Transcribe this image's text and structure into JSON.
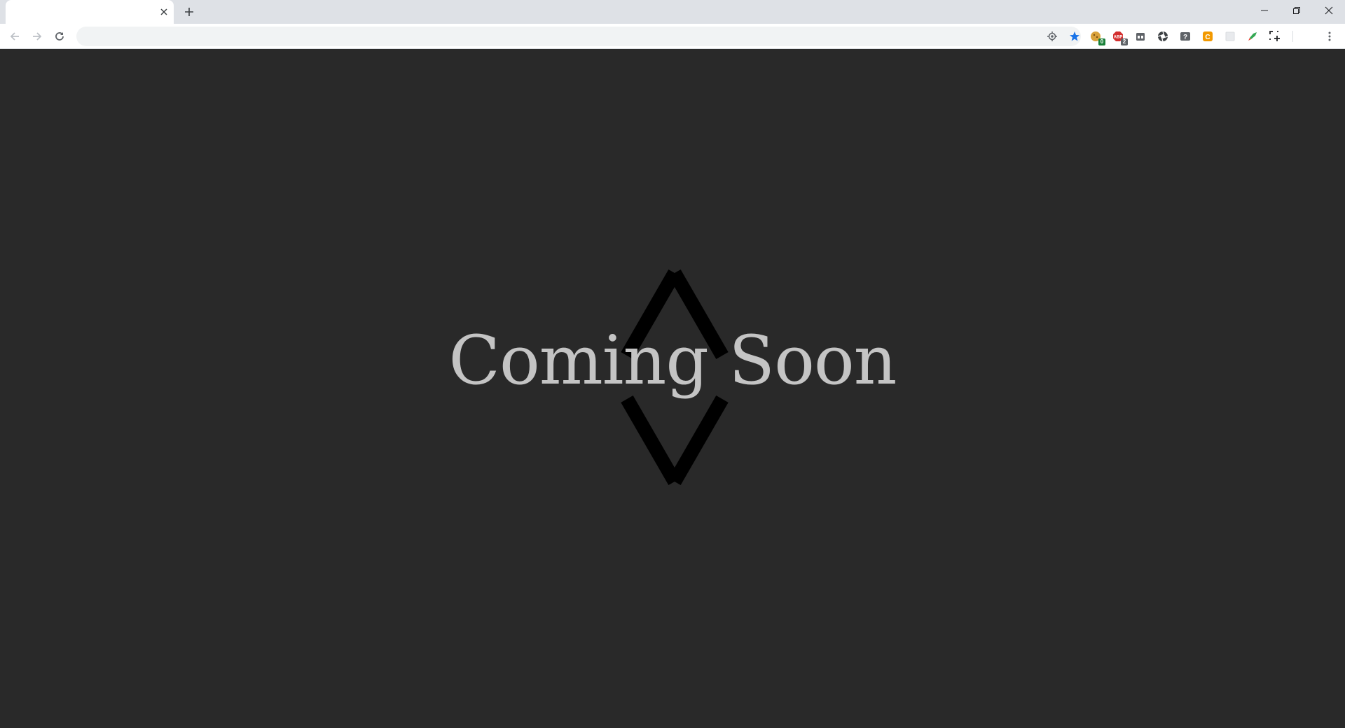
{
  "browser": {
    "tab": {
      "title": ""
    },
    "omnibox": {
      "value": "",
      "placeholder": ""
    },
    "extensions": [
      {
        "icon": "cookie-extension-icon",
        "badge": "0",
        "badge_color": "#188038"
      },
      {
        "icon": "adblock-extension-icon",
        "badge": "2",
        "badge_color": "#5f6368"
      },
      {
        "icon": "store-extension-icon"
      },
      {
        "icon": "aperture-extension-icon"
      },
      {
        "icon": "help-extension-icon"
      },
      {
        "icon": "c-extension-icon"
      },
      {
        "icon": "blank-extension-icon"
      },
      {
        "icon": "rocket-extension-icon"
      },
      {
        "icon": "screenshot-extension-icon"
      }
    ]
  },
  "page": {
    "headline": "Coming Soon",
    "colors": {
      "background": "#292929",
      "headline": "#c4c4c4",
      "diamond": "#000000",
      "bookmark_star": "#1a73e8"
    }
  }
}
